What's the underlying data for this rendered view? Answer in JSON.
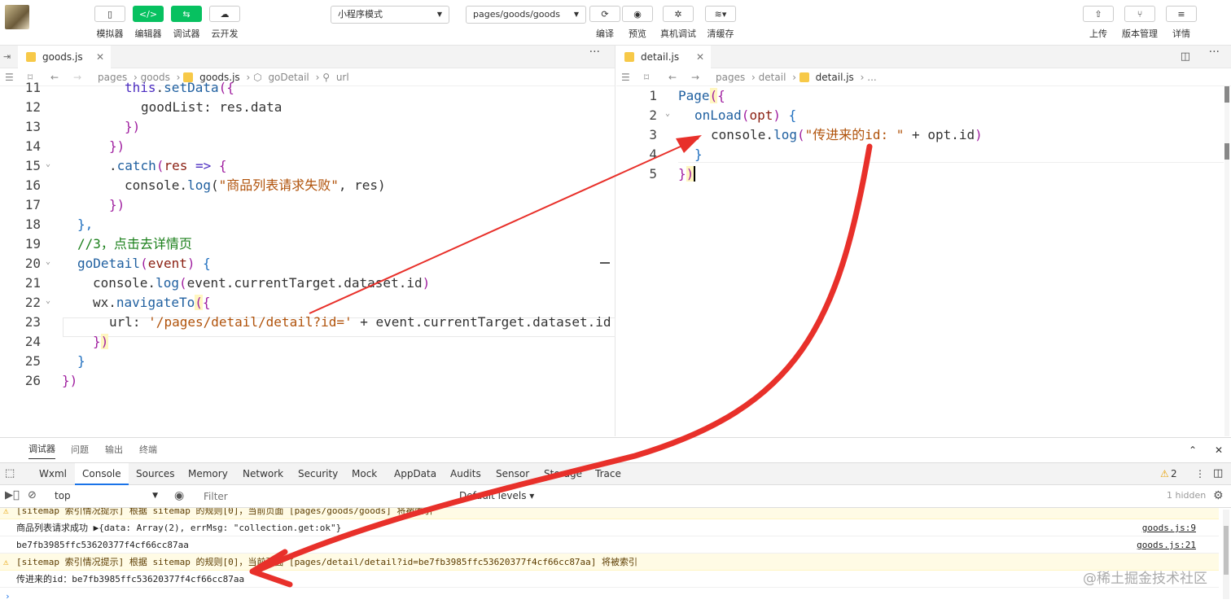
{
  "toolbar": {
    "left_buttons": [
      {
        "icon": "phone-icon",
        "label": "模拟器"
      },
      {
        "icon": "code-icon",
        "label": "编辑器"
      },
      {
        "icon": "debug-icon",
        "label": "调试器"
      },
      {
        "icon": "cloud-icon",
        "label": "云开发"
      }
    ],
    "mode_select": "小程序模式",
    "page_select": "pages/goods/goods",
    "mid_buttons": [
      {
        "icon": "refresh-icon",
        "label": "编译"
      },
      {
        "icon": "eye-icon",
        "label": "预览"
      },
      {
        "icon": "bug-icon",
        "label": "真机调试"
      },
      {
        "icon": "layers-icon",
        "label": "清缓存"
      }
    ],
    "right_buttons": [
      {
        "icon": "upload-icon",
        "label": "上传"
      },
      {
        "icon": "branch-icon",
        "label": "版本管理"
      },
      {
        "icon": "menu-icon",
        "label": "详情"
      }
    ]
  },
  "left_editor": {
    "tab": "goods.js",
    "breadcrumb": [
      "pages",
      "goods",
      "goods.js",
      "goDetail",
      "url"
    ],
    "lines": [
      {
        "n": "11",
        "text": "this.setData({"
      },
      {
        "n": "12",
        "text": "goodList: res.data"
      },
      {
        "n": "13",
        "text": "})"
      },
      {
        "n": "14",
        "text": "})"
      },
      {
        "n": "15",
        "text": ".catch(res => {"
      },
      {
        "n": "16",
        "text": "console.log(\"商品列表请求失败\", res)"
      },
      {
        "n": "17",
        "text": "})"
      },
      {
        "n": "18",
        "text": "},"
      },
      {
        "n": "19",
        "text": "//3，点击去详情页"
      },
      {
        "n": "20",
        "text": "goDetail(event) {"
      },
      {
        "n": "21",
        "text": "console.log(event.currentTarget.dataset.id)"
      },
      {
        "n": "22",
        "text": "wx.navigateTo({"
      },
      {
        "n": "23",
        "text": "url: '/pages/detail/detail?id=' + event.currentTarget.dataset.id"
      },
      {
        "n": "24",
        "text": "})"
      },
      {
        "n": "25",
        "text": "}"
      },
      {
        "n": "26",
        "text": "})"
      }
    ]
  },
  "right_editor": {
    "tab": "detail.js",
    "breadcrumb": [
      "pages",
      "detail",
      "detail.js",
      "..."
    ],
    "lines": [
      {
        "n": "1",
        "text": "Page({"
      },
      {
        "n": "2",
        "text": "onLoad(opt) {"
      },
      {
        "n": "3",
        "text": "console.log(\"传进来的id：\" + opt.id)"
      },
      {
        "n": "4",
        "text": "}"
      },
      {
        "n": "5",
        "text": "})"
      }
    ]
  },
  "devtools": {
    "top_tabs": [
      "调试器",
      "问题",
      "输出",
      "终端"
    ],
    "panel_tabs": [
      "Wxml",
      "Console",
      "Sources",
      "Memory",
      "Network",
      "Security",
      "Mock",
      "AppData",
      "Audits",
      "Sensor",
      "Storage",
      "Trace"
    ],
    "active_panel": "Console",
    "warning_count": "2",
    "context": "top",
    "filter_placeholder": "Filter",
    "levels": "Default levels",
    "hidden": "1 hidden",
    "logs": [
      {
        "type": "warn",
        "text": "[sitemap 索引情况提示] 根据 sitemap 的规则[0]，当前页面 [pages/goods/goods] 将被索引",
        "source": ""
      },
      {
        "type": "log",
        "text": "商品列表请求成功 ▶{data: Array(2), errMsg: \"collection.get:ok\"}",
        "source": "goods.js:9"
      },
      {
        "type": "log",
        "text": "be7fb3985ffc53620377f4cf66cc87aa",
        "source": "goods.js:21"
      },
      {
        "type": "warn",
        "text": "[sitemap 索引情况提示] 根据 sitemap 的规则[0]，当前页面 [pages/detail/detail?id=be7fb3985ffc53620377f4cf66cc87aa] 将被索引",
        "source": ""
      },
      {
        "type": "log",
        "text": "传进来的id：be7fb3985ffc53620377f4cf66cc87aa",
        "source": ""
      }
    ],
    "prompt": "›"
  },
  "watermark": "@稀土掘金技术社区",
  "annotation_color": "#e8302a"
}
